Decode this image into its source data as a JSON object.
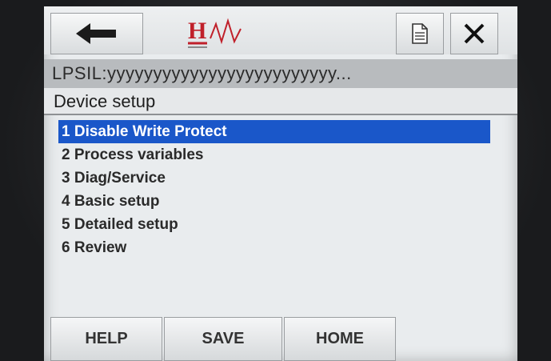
{
  "header": {
    "back_icon": "left-arrow-icon",
    "logo_text": "H",
    "document_icon": "document-icon",
    "close_icon": "close-x-icon"
  },
  "device_tag": "LPSIL:yyyyyyyyyyyyyyyyyyyyyyyyy...",
  "screen_title": "Device setup",
  "menu": {
    "items": [
      {
        "label": "1 Disable Write Protect",
        "selected": true
      },
      {
        "label": "2 Process variables",
        "selected": false
      },
      {
        "label": "3 Diag/Service",
        "selected": false
      },
      {
        "label": "4 Basic setup",
        "selected": false
      },
      {
        "label": "5 Detailed setup",
        "selected": false
      },
      {
        "label": "6 Review",
        "selected": false
      }
    ]
  },
  "softkeys": {
    "help": "HELP",
    "save": "SAVE",
    "home": "HOME"
  },
  "colors": {
    "selection": "#1a57c9",
    "logo_red": "#c0202a"
  }
}
